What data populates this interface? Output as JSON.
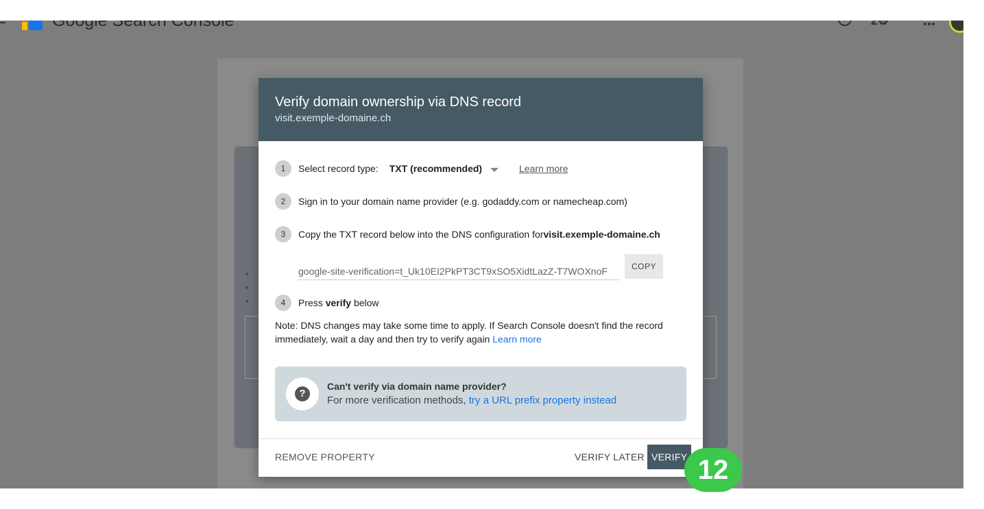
{
  "app": {
    "title": "Google Search Console"
  },
  "dialog": {
    "title": "Verify domain ownership via DNS record",
    "subtitle": "visit.exemple-domaine.ch",
    "steps": [
      {
        "num": "1",
        "label": "Select record type:",
        "value": "TXT (recommended)",
        "link": "Learn more"
      },
      {
        "num": "2",
        "text": "Sign in to your domain name provider (e.g. godaddy.com or namecheap.com)"
      },
      {
        "num": "3",
        "text_prefix": "Copy the TXT record below into the DNS configuration for ",
        "domain": "visit.exemple-domaine.ch"
      },
      {
        "num": "4",
        "text_prefix": "Press ",
        "emph": "verify",
        "text_suffix": " below"
      }
    ],
    "txt_record": "google-site-verification=t_Uk10EI2PkPT3CT9xSO5XidtLazZ-T7WOXnoF",
    "copy_label": "COPY",
    "note": "Note: DNS changes may take some time to apply. If Search Console doesn't find the record immediately, wait a day and then try to verify again",
    "note_link": "Learn more",
    "alt": {
      "title": "Can't verify via domain name provider?",
      "text": "For more verification methods, ",
      "link": "try a URL prefix property instead"
    },
    "remove_label": "REMOVE PROPERTY",
    "verify_later_label": "VERIFY LATER",
    "verify_label": "VERIFY"
  },
  "badge": "12",
  "colors": {
    "header": "#455a64",
    "link": "#1a73e8",
    "badge": "#3cc84a"
  }
}
